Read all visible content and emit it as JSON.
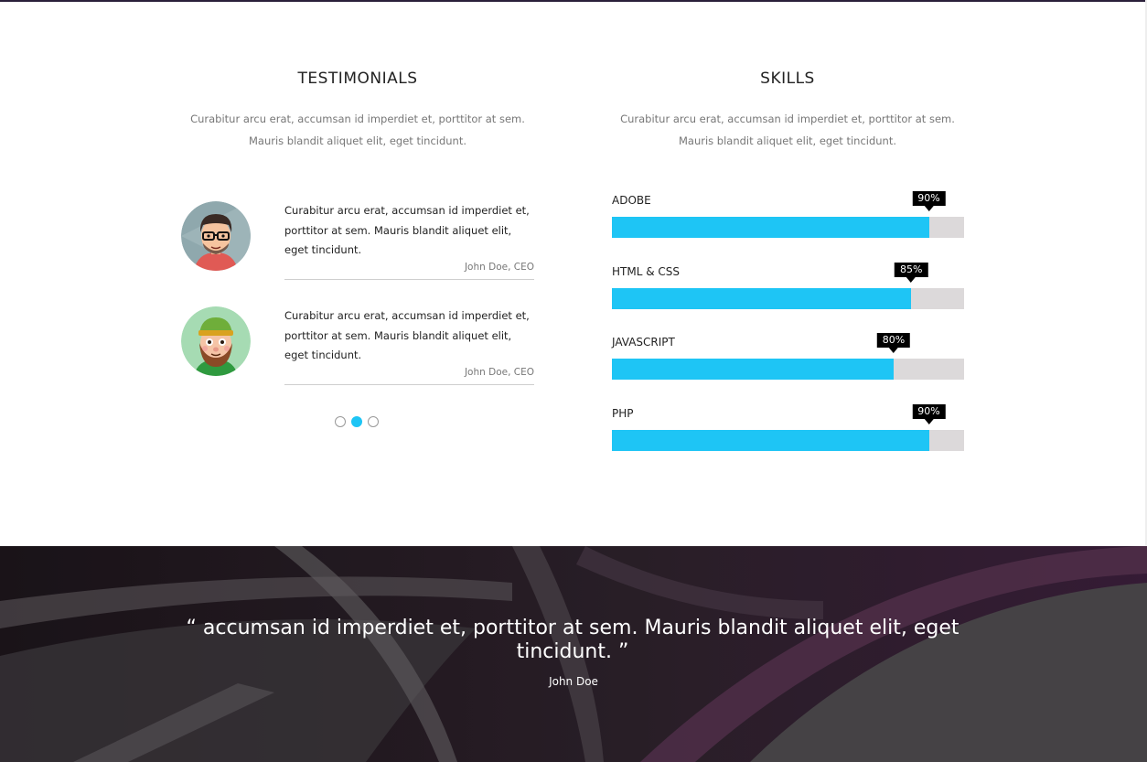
{
  "testimonials": {
    "title": "TESTIMONIALS",
    "intro_line1": "Curabitur arcu erat, accumsan id imperdiet et, porttitor at sem.",
    "intro_line2": "Mauris blandit aliquet elit, eget tincidunt.",
    "items": [
      {
        "text": "Curabitur arcu erat, accumsan id imperdiet et, porttitor at sem. Mauris blandit aliquet elit, eget tincidunt.",
        "author": "John Doe, CEO",
        "avatar": "man-with-glasses-avatar"
      },
      {
        "text": "Curabitur arcu erat, accumsan id imperdiet et, porttitor at sem. Mauris blandit aliquet elit, eget tincidunt.",
        "author": "John Doe, CEO",
        "avatar": "bearded-man-with-cap-avatar"
      }
    ],
    "pagination": {
      "count": 3,
      "active_index": 1
    }
  },
  "skills": {
    "title": "SKILLS",
    "intro_line1": "Curabitur arcu erat, accumsan id imperdiet et, porttitor at sem.",
    "intro_line2": "Mauris blandit aliquet elit, eget tincidunt.",
    "items": [
      {
        "name": "ADOBE",
        "percent": 90,
        "label": "90%"
      },
      {
        "name": "HTML & CSS",
        "percent": 85,
        "label": "85%"
      },
      {
        "name": "JAVASCRIPT",
        "percent": 80,
        "label": "80%"
      },
      {
        "name": "PHP",
        "percent": 90,
        "label": "90%"
      }
    ]
  },
  "quote_banner": {
    "text": "“ accumsan id imperdiet et, porttitor at sem. Mauris blandit aliquet elit, eget tincidunt. ”",
    "author": "John Doe"
  },
  "colors": {
    "accent": "#1ec5f5",
    "track": "#dcd9da",
    "badge": "#000000"
  }
}
